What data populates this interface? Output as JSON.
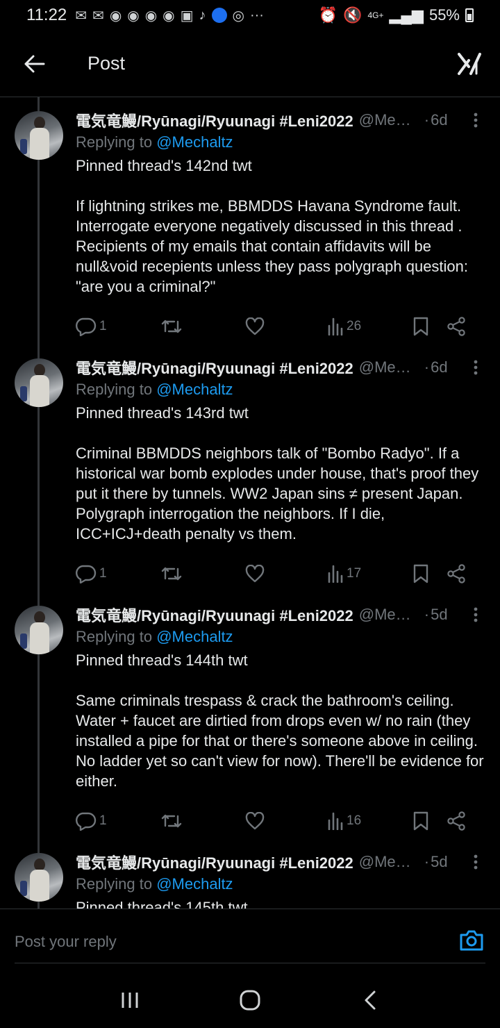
{
  "status_bar": {
    "time": "11:22",
    "notif_icons": [
      "M",
      "M",
      "discord-icon",
      "discord-icon",
      "discord-icon",
      "discord-icon",
      "shopee-icon",
      "tiktok-icon",
      "shop-icon",
      "instagram-icon",
      "more-icon"
    ],
    "network": "4G+",
    "battery": "55%"
  },
  "header": {
    "title": "Post"
  },
  "tweets": [
    {
      "author": "電気竜鰻/Ryūnagi/Ryuunagi #Leni2022",
      "handle": "@Mec...",
      "age": "6d",
      "replying_prefix": "Replying to ",
      "replying_to": "@Mechaltz",
      "text": "Pinned thread's 142nd twt\n\nIf lightning strikes me, BBMDDS Havana Syndrome fault. Interrogate everyone negatively discussed in this thread . Recipients of my emails that contain affidavits will be null&void recepients unless they pass polygraph question: \"are you a criminal?\"",
      "replies": "1",
      "views": "26"
    },
    {
      "author": "電気竜鰻/Ryūnagi/Ryuunagi #Leni2022",
      "handle": "@Mec...",
      "age": "6d",
      "replying_prefix": "Replying to ",
      "replying_to": "@Mechaltz",
      "text": "Pinned thread's 143rd twt\n\nCriminal BBMDDS neighbors talk of \"Bombo Radyo\". If a historical war bomb explodes under house, that's proof they put it there by tunnels. WW2 Japan sins ≠ present Japan. Polygraph interrogation the neighbors. If I die, ICC+ICJ+death penalty vs them.",
      "replies": "1",
      "views": "17"
    },
    {
      "author": "電気竜鰻/Ryūnagi/Ryuunagi #Leni2022",
      "handle": "@Mec...",
      "age": "5d",
      "replying_prefix": "Replying to ",
      "replying_to": "@Mechaltz",
      "text": "Pinned thread's 144th twt\n\nSame criminals trespass & crack the bathroom's ceiling. Water + faucet are dirtied from drops even w/ no rain (they installed a pipe for that or there's someone above in ceiling. No ladder yet so can't view for now). There'll be evidence for either.",
      "replies": "1",
      "views": "16"
    },
    {
      "author": "電気竜鰻/Ryūnagi/Ryuunagi #Leni2022",
      "handle": "@Mec...",
      "age": "5d",
      "replying_prefix": "Replying to ",
      "replying_to": "@Mechaltz",
      "text": "Pinned thread's 145th twt",
      "replies": "",
      "views": ""
    }
  ],
  "reply_bar": {
    "placeholder": "Post your reply"
  },
  "colors": {
    "background": "#000000",
    "text": "#e7e9ea",
    "muted": "#71767b",
    "link": "#1d9bf0",
    "divider": "#2f3336"
  }
}
